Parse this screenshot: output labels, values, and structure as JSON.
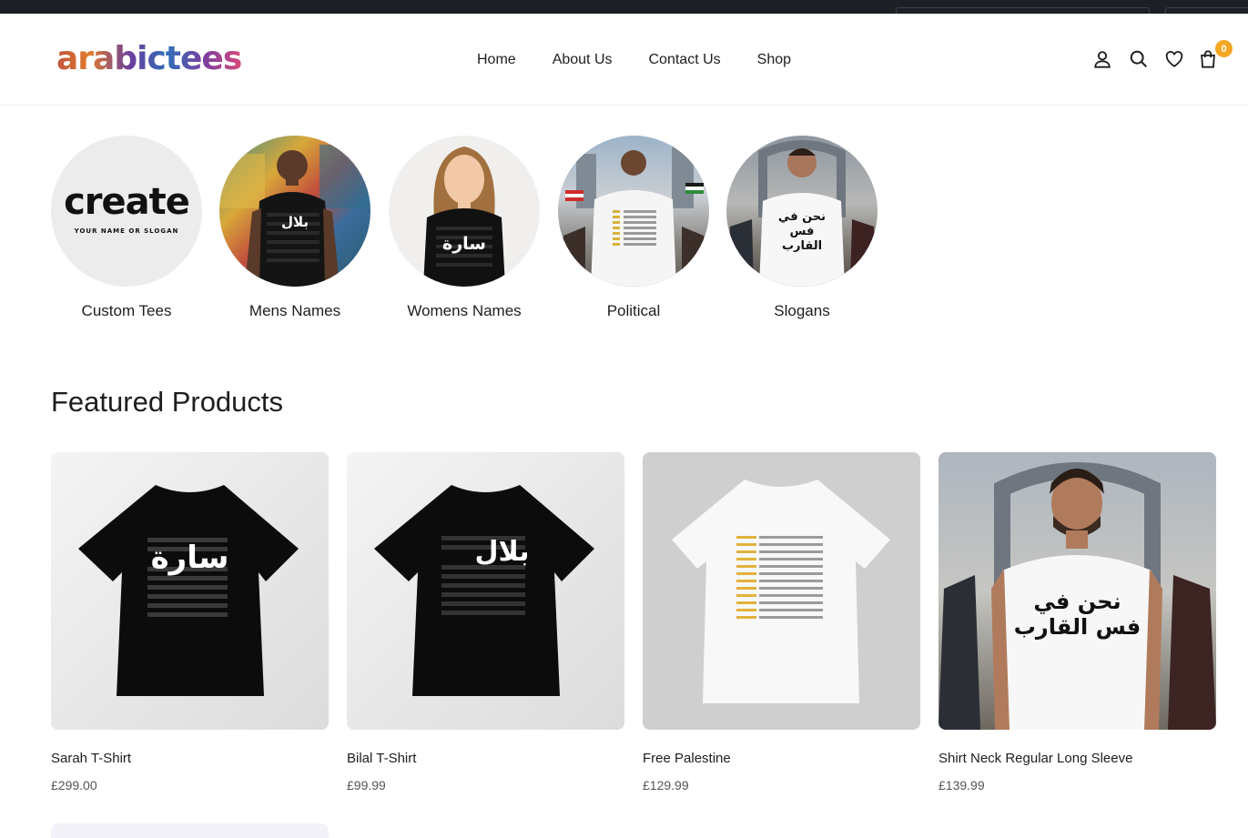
{
  "brand": {
    "logo_text": "arabictees"
  },
  "nav": {
    "items": [
      "Home",
      "About Us",
      "Contact Us",
      "Shop"
    ]
  },
  "header_icons": {
    "account": "user-icon",
    "search": "search-icon",
    "wishlist": "heart-icon",
    "cart": "bag-icon",
    "cart_count": "0",
    "badge_color": "#f5a623"
  },
  "categories": [
    {
      "label": "Custom Tees",
      "image_text": "create",
      "image_subtext": "YOUR NAME OR SLOGAN"
    },
    {
      "label": "Mens Names",
      "image_text": "بلال"
    },
    {
      "label": "Womens Names",
      "image_text": "سارة"
    },
    {
      "label": "Political"
    },
    {
      "label": "Slogans",
      "image_text": "نحن في فس القارب"
    }
  ],
  "featured": {
    "title": "Featured Products",
    "products": [
      {
        "name": "Sarah T-Shirt",
        "price": "£299.00",
        "print_text": "سارة"
      },
      {
        "name": "Bilal T-Shirt",
        "price": "£99.99",
        "print_text": "بلال"
      },
      {
        "name": "Free Palestine",
        "price": "£129.99"
      },
      {
        "name": "Shirt Neck Regular Long Sleeve",
        "price": "£139.99",
        "print_text": "نحن في فس القارب"
      }
    ]
  }
}
